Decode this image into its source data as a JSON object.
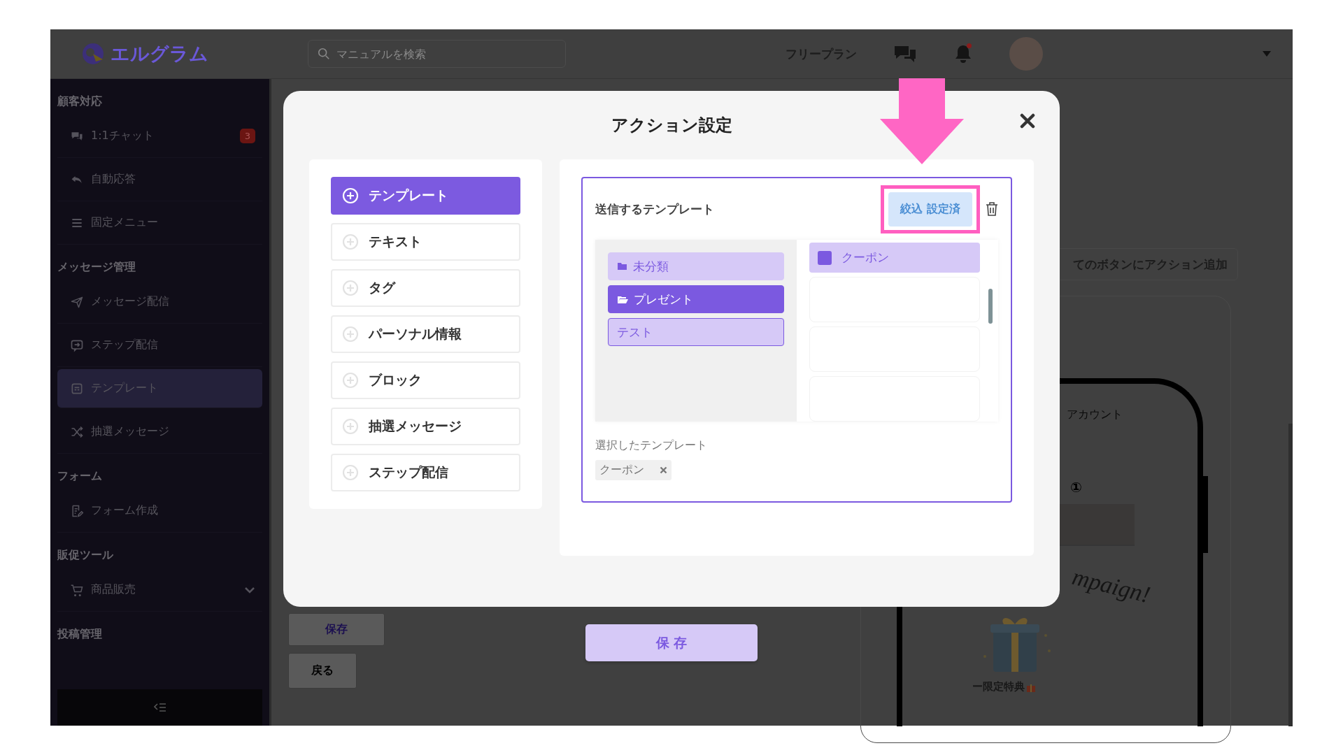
{
  "topbar": {
    "logo": "エルグラム",
    "search": {
      "placeholder": "マニュアルを検索"
    },
    "plan": "フリープラン",
    "bell_unread": true
  },
  "sidebar": {
    "sections": [
      {
        "title": "顧客対応",
        "items": [
          {
            "kind": "chat",
            "label": "1:1チャット",
            "badge": "3",
            "selected": false
          },
          {
            "kind": "reply",
            "label": "自動応答",
            "selected": false
          },
          {
            "kind": "menu",
            "label": "固定メニュー",
            "selected": false
          }
        ]
      },
      {
        "title": "メッセージ管理",
        "items": [
          {
            "kind": "send",
            "label": "メッセージ配信",
            "selected": false
          },
          {
            "kind": "step",
            "label": "ステップ配信",
            "selected": false
          },
          {
            "kind": "template",
            "label": "テンプレート",
            "selected": true
          },
          {
            "kind": "shuffle",
            "label": "抽選メッセージ",
            "selected": false
          }
        ]
      },
      {
        "title": "フォーム",
        "items": [
          {
            "kind": "form",
            "label": "フォーム作成",
            "selected": false
          }
        ]
      },
      {
        "title": "販促ツール",
        "items": [
          {
            "kind": "cart",
            "label": "商品販売",
            "selected": false,
            "expandable": true
          }
        ]
      },
      {
        "title": "投稿管理"
      }
    ]
  },
  "background": {
    "action_button": "てのボタンにアクション追加",
    "preview": {
      "account": "アカウント",
      "mark": "①",
      "headline": "mpaign!",
      "caption": "ー限定特典"
    },
    "save_button": "保存",
    "back_button": "戻る"
  },
  "modal": {
    "title": "アクション設定",
    "actions": [
      {
        "label": "テンプレート",
        "selected": true
      },
      {
        "label": "テキスト",
        "selected": false
      },
      {
        "label": "タグ",
        "selected": false
      },
      {
        "label": "パーソナル情報",
        "selected": false
      },
      {
        "label": "ブロック",
        "selected": false
      },
      {
        "label": "抽選メッセージ",
        "selected": false
      },
      {
        "label": "ステップ配信",
        "selected": false
      }
    ],
    "template_box": {
      "heading": "送信するテンプレート",
      "filter_button": "絞込 設定済",
      "folders": [
        {
          "kind": "folder",
          "label": "未分類",
          "selected": false,
          "focused": false
        },
        {
          "kind": "folder",
          "label": "プレゼント",
          "selected": true,
          "focused": false
        },
        {
          "kind": "plain",
          "label": "テスト",
          "selected": false,
          "focused": true
        }
      ],
      "templates": [
        {
          "label": "クーポン",
          "checked": true
        }
      ],
      "selected_label": "選択したテンプレート",
      "selected_chips": [
        {
          "label": "クーポン"
        }
      ]
    },
    "save_button": "保 存"
  }
}
